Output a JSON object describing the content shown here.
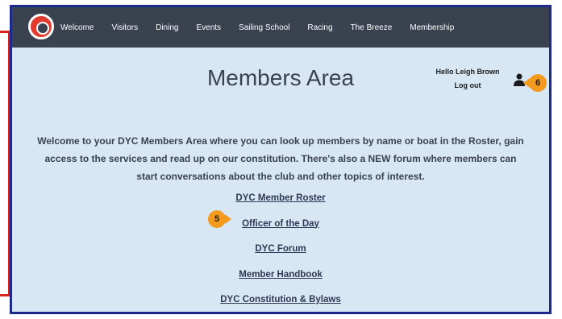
{
  "nav": {
    "items": [
      "Welcome",
      "Visitors",
      "Dining",
      "Events",
      "Sailing School",
      "Racing",
      "The Breeze",
      "Membership"
    ]
  },
  "main": {
    "title": "Members Area",
    "welcome_text": "Welcome to your DYC Members Area where you can look up members by name or boat in the Roster, gain access to the services and read up on our constitution. There's also a NEW forum where members can start conversations about the club and other topics of interest.",
    "links": [
      "DYC Member Roster",
      "Officer of the Day",
      "DYC Forum",
      "Member Handbook",
      "DYC Constitution & Bylaws"
    ]
  },
  "user": {
    "greeting": "Hello Leigh Brown",
    "logout": "Log out"
  },
  "callouts": {
    "five": "5",
    "six": "6"
  },
  "colors": {
    "navbar": "#3a4250",
    "content_bg": "#d7e7f3",
    "callout": "#f39a1f",
    "frame_blue": "#1b2a8c",
    "frame_red": "#d9221d"
  }
}
